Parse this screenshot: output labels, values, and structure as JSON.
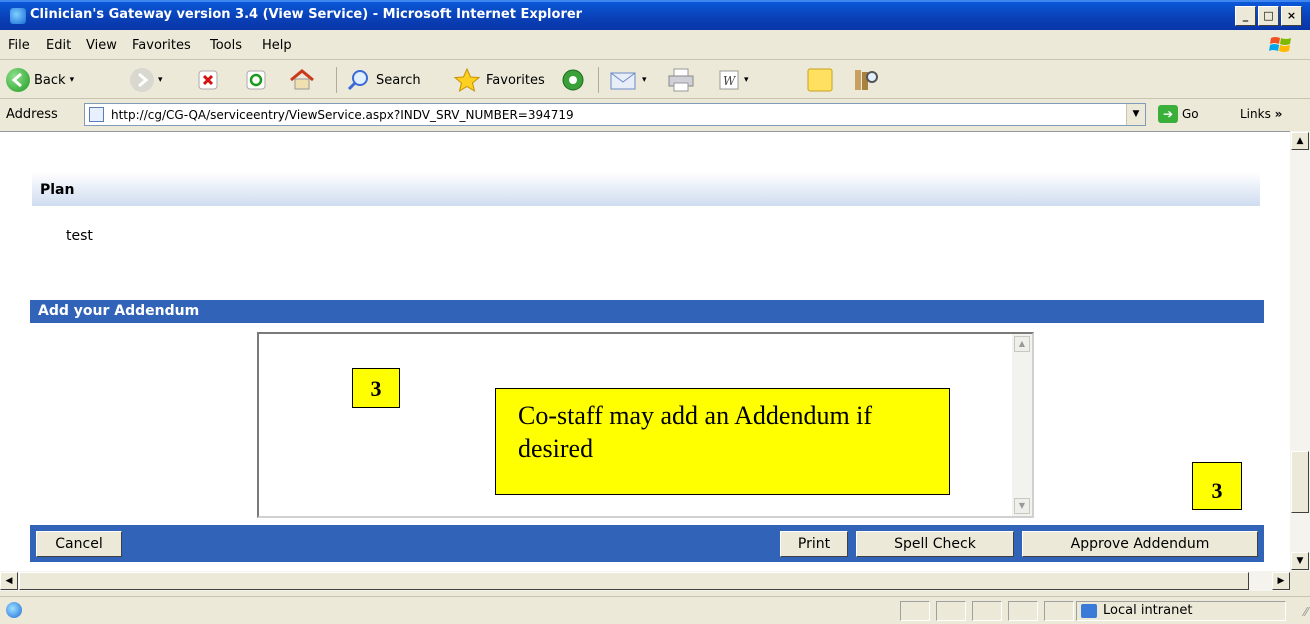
{
  "window": {
    "title": "Clinician's Gateway version 3.4 (View Service) - Microsoft Internet Explorer",
    "minimize": "_",
    "maximize": "□",
    "close": "×"
  },
  "menu": [
    "File",
    "Edit",
    "View",
    "Favorites",
    "Tools",
    "Help"
  ],
  "toolbar": {
    "back": "Back",
    "search": "Search",
    "favorites": "Favorites"
  },
  "address": {
    "label": "Address",
    "url": "http://cg/CG-QA/serviceentry/ViewService.aspx?INDV_SRV_NUMBER=394719",
    "go": "Go",
    "links": "Links"
  },
  "sections": {
    "plan_title": "Plan",
    "plan_text": "test",
    "addendum_title": "Add your Addendum",
    "addendum_value": ""
  },
  "callouts": {
    "step_top": "3",
    "step_bottom": "3",
    "note": "Co-staff may add an Addendum if desired"
  },
  "buttons": {
    "cancel": "Cancel",
    "print": "Print",
    "spell_check": "Spell Check",
    "approve": "Approve Addendum"
  },
  "status": {
    "zone": "Local intranet"
  },
  "colors": {
    "header_blue": "#3163b8",
    "callout_yellow": "#ffff00",
    "xp_title_blue": "#0a58d8"
  }
}
